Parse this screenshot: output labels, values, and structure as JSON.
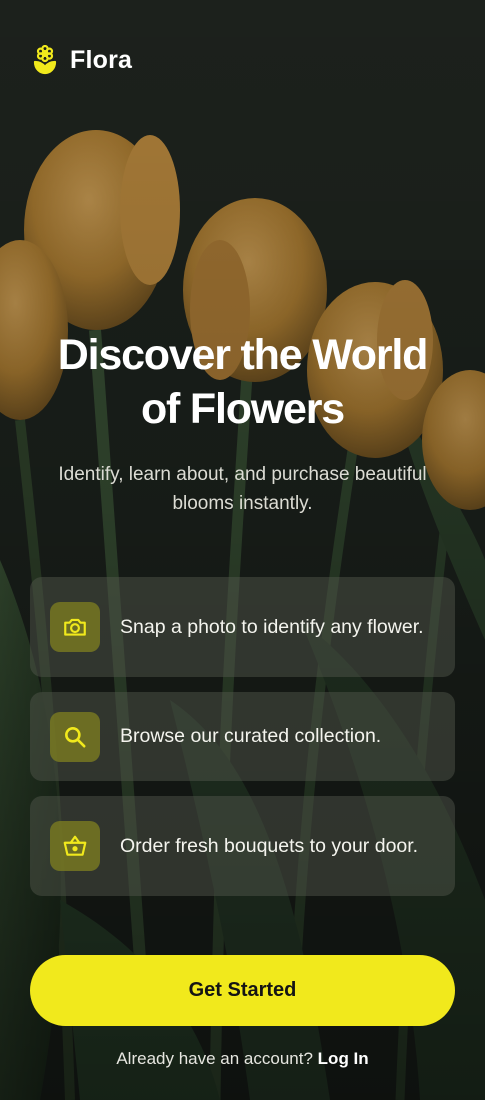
{
  "brand": {
    "name": "Flora",
    "icon": "flower-icon",
    "accent_color": "#f1e91c"
  },
  "hero": {
    "title_line1": "Discover the World",
    "title_line2": "of Flowers",
    "subtitle_line1": "Identify, learn about, and purchase beautiful",
    "subtitle_line2": "blooms instantly."
  },
  "features": [
    {
      "icon": "camera-icon",
      "text": "Snap a photo to identify any flower."
    },
    {
      "icon": "search-icon",
      "text": "Browse our curated collection."
    },
    {
      "icon": "basket-icon",
      "text": "Order fresh bouquets to your door."
    }
  ],
  "cta": {
    "label": "Get Started",
    "color": "#f1e91c"
  },
  "login": {
    "prompt": "Already have an account?",
    "link_label": "Log In"
  },
  "background": {
    "image": "yellow-tulips-photo",
    "base_color": "#1d241d"
  }
}
